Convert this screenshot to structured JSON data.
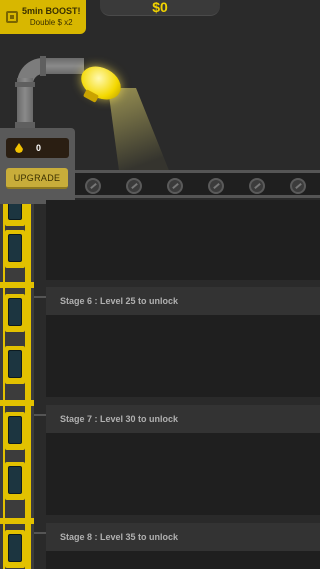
{
  "header": {
    "money": "$0"
  },
  "boost": {
    "title": "5min BOOST!",
    "subtitle": "Double $ x2"
  },
  "panel": {
    "resource_count": "0",
    "upgrade_label": "UPGRADE"
  },
  "stages": [
    {
      "label": "Stage 6 : Level 25 to unlock"
    },
    {
      "label": "Stage 7 : Level 30 to unlock"
    },
    {
      "label": "Stage 8 : Level 35 to unlock"
    }
  ],
  "colors": {
    "accent": "#e2c100",
    "background": "#2a2a2a",
    "panel": "#595959"
  }
}
